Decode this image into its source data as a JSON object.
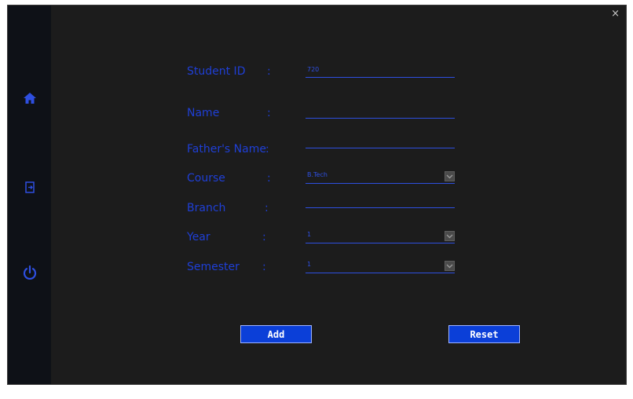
{
  "window": {
    "close_label": "×"
  },
  "sidebar": {
    "items": [
      {
        "icon": "home-icon"
      },
      {
        "icon": "logout-icon"
      },
      {
        "icon": "power-icon"
      }
    ],
    "accent": "#1f3fd6"
  },
  "form": {
    "separator": ":",
    "student_id": {
      "label": "Student ID",
      "value": "720"
    },
    "name": {
      "label": "Name",
      "value": ""
    },
    "father_name": {
      "label": "Father's Name",
      "value": ""
    },
    "course": {
      "label": "Course",
      "value": "B.Tech"
    },
    "branch": {
      "label": "Branch",
      "value": ""
    },
    "year": {
      "label": "Year",
      "value": "1"
    },
    "semester": {
      "label": "Semester",
      "value": "1"
    }
  },
  "buttons": {
    "add": "Add",
    "reset": "Reset"
  },
  "colors": {
    "background": "#1c1c1c",
    "sidebar": "#0e1117",
    "label": "#1f3fd6",
    "button": "#0b3fd8"
  }
}
